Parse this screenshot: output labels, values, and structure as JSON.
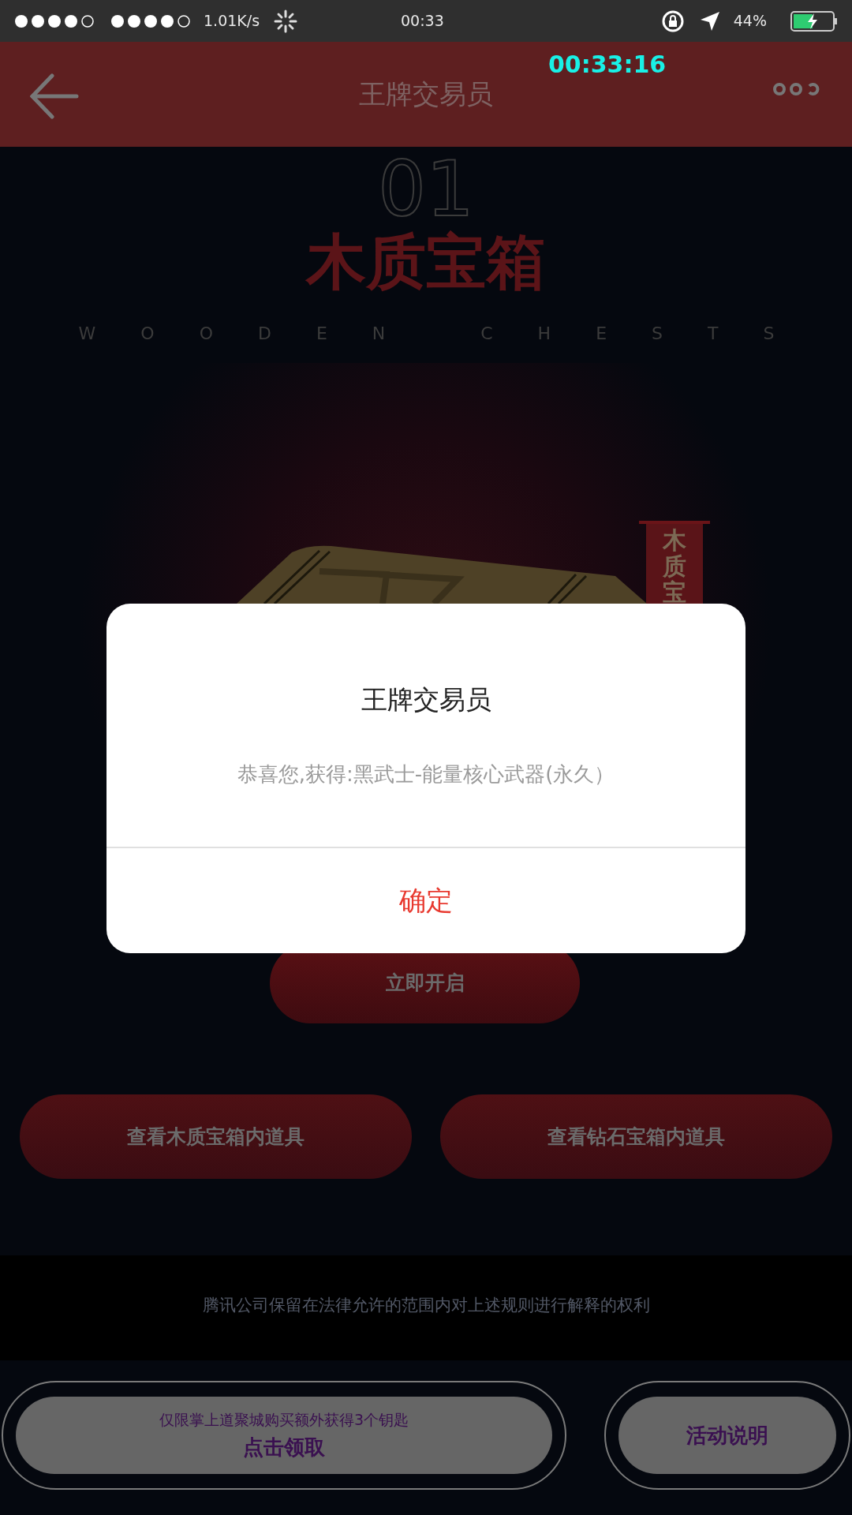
{
  "status_bar": {
    "network_speed": "1.01K/s",
    "time": "00:33",
    "battery": "44%"
  },
  "recording_timer": "00:33:16",
  "header": {
    "title": "王牌交易员"
  },
  "chest": {
    "number": "01",
    "title": "木质宝箱",
    "subtitle": "WOODEN CHESTS",
    "banner": "木质宝"
  },
  "open_button": "立即开启",
  "view_buttons": [
    "查看木质宝箱内道具",
    "查看钻石宝箱内道具"
  ],
  "footer_note": "腾讯公司保留在法律允许的范围内对上述规则进行解释的权利",
  "bottom_bar": {
    "claim": {
      "note": "仅限掌上道聚城购买额外获得3个钥匙",
      "label": "点击领取"
    },
    "rules_button": "活动说明"
  },
  "dialog": {
    "title": "王牌交易员",
    "message": "恭喜您,获得:黑武士-能量核心武器(永久）",
    "confirm": "确定"
  }
}
